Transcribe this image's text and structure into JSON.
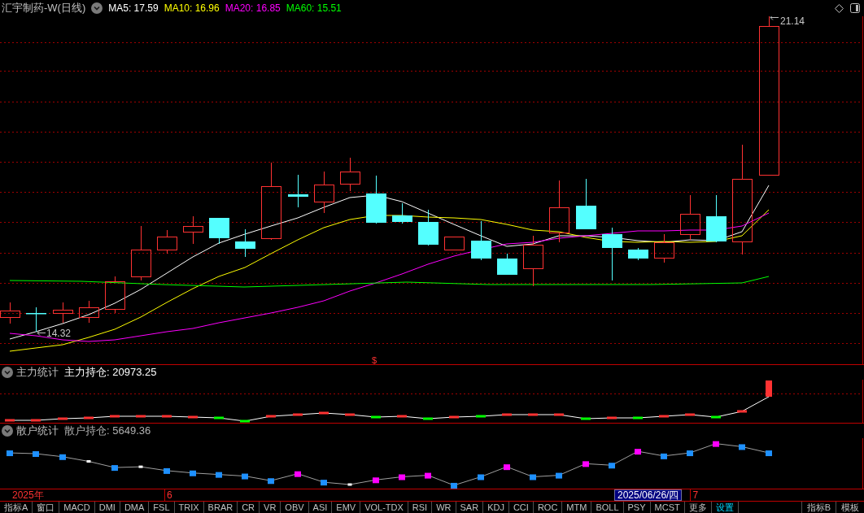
{
  "chart_header": {
    "title": "汇宇制药-W(日线)",
    "indicators": [
      {
        "label": "MA5: 17.59",
        "color": "#ffffff"
      },
      {
        "label": "MA10: 16.96",
        "color": "#ffff00"
      },
      {
        "label": "MA20: 16.85",
        "color": "#ff00ff"
      },
      {
        "label": "MA60: 15.51",
        "color": "#00ff00"
      }
    ]
  },
  "price_chart": {
    "high_label": "21.14",
    "low_label": "14.32",
    "marker_symbol": "$"
  },
  "main_force_panel": {
    "title": "主力统计",
    "reading": "主力持仓: 20973.25"
  },
  "retail_panel": {
    "title": "散户统计",
    "reading": "散户持仓: 5649.36"
  },
  "date_axis": {
    "year_label": "2025年",
    "month_label": "6",
    "cursor_date": "2025/06/26/四",
    "next_month_label": "7"
  },
  "indicator_tabs": [
    {
      "label": "指标A",
      "kind": "tab"
    },
    {
      "label": "窗口",
      "kind": "tab"
    },
    {
      "label": "MACD",
      "kind": "tab"
    },
    {
      "label": "DMI",
      "kind": "tab"
    },
    {
      "label": "DMA",
      "kind": "tab"
    },
    {
      "label": "FSL",
      "kind": "tab"
    },
    {
      "label": "TRIX",
      "kind": "tab"
    },
    {
      "label": "BRAR",
      "kind": "tab"
    },
    {
      "label": "CR",
      "kind": "tab"
    },
    {
      "label": "VR",
      "kind": "tab"
    },
    {
      "label": "OBV",
      "kind": "tab"
    },
    {
      "label": "ASI",
      "kind": "tab"
    },
    {
      "label": "EMV",
      "kind": "tab"
    },
    {
      "label": "VOL-TDX",
      "kind": "tab"
    },
    {
      "label": "RSI",
      "kind": "tab"
    },
    {
      "label": "WR",
      "kind": "tab"
    },
    {
      "label": "SAR",
      "kind": "tab"
    },
    {
      "label": "KDJ",
      "kind": "tab"
    },
    {
      "label": "CCI",
      "kind": "tab"
    },
    {
      "label": "ROC",
      "kind": "tab"
    },
    {
      "label": "MTM",
      "kind": "tab"
    },
    {
      "label": "BOLL",
      "kind": "tab"
    },
    {
      "label": "PSY",
      "kind": "tab"
    },
    {
      "label": "MCST",
      "kind": "tab"
    },
    {
      "label": "更多",
      "kind": "tab"
    },
    {
      "label": "设置",
      "kind": "settings"
    }
  ],
  "right_tabs": [
    {
      "label": "指标B"
    },
    {
      "label": "模板"
    }
  ]
}
